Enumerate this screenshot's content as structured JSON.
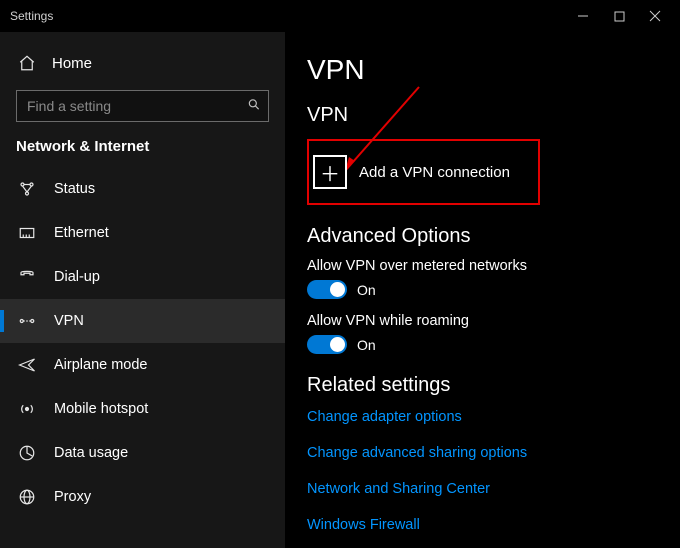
{
  "window": {
    "title": "Settings"
  },
  "sidebar": {
    "home": "Home",
    "search_placeholder": "Find a setting",
    "section": "Network & Internet",
    "items": [
      {
        "label": "Status",
        "icon": "status"
      },
      {
        "label": "Ethernet",
        "icon": "ethernet"
      },
      {
        "label": "Dial-up",
        "icon": "dialup"
      },
      {
        "label": "VPN",
        "icon": "vpn",
        "active": true
      },
      {
        "label": "Airplane mode",
        "icon": "airplane"
      },
      {
        "label": "Mobile hotspot",
        "icon": "hotspot"
      },
      {
        "label": "Data usage",
        "icon": "data"
      },
      {
        "label": "Proxy",
        "icon": "proxy"
      }
    ]
  },
  "main": {
    "title": "VPN",
    "section1_heading": "VPN",
    "add_label": "Add a VPN connection",
    "adv_heading": "Advanced Options",
    "opt1_label": "Allow VPN over metered networks",
    "opt1_state": "On",
    "opt2_label": "Allow VPN while roaming",
    "opt2_state": "On",
    "related_heading": "Related settings",
    "links": [
      "Change adapter options",
      "Change advanced sharing options",
      "Network and Sharing Center",
      "Windows Firewall"
    ]
  },
  "colors": {
    "accent": "#0078d4",
    "link": "#0395ff",
    "highlight": "#e20000"
  }
}
